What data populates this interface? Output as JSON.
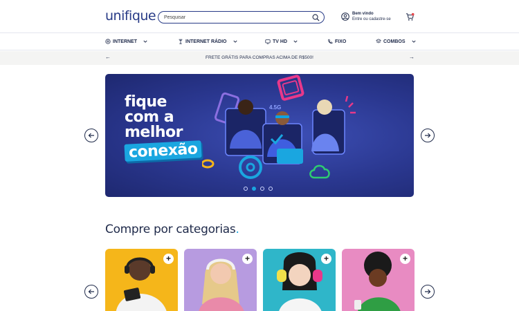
{
  "header": {
    "logo": "unifique",
    "search_placeholder": "Pesquisar",
    "user_greeting": "Bem vindo",
    "user_sub": "Entre ou cadastre-se"
  },
  "nav": {
    "items": [
      {
        "label": "INTERNET",
        "icon": "globe-icon"
      },
      {
        "label": "INTERNET RÁDIO",
        "icon": "antenna-icon"
      },
      {
        "label": "TV HD",
        "icon": "tv-icon"
      },
      {
        "label": "FIXO",
        "icon": "phone-icon"
      },
      {
        "label": "COMBOS",
        "icon": "combo-icon"
      }
    ]
  },
  "promo": {
    "text": "FRETE GRÁTIS PARA COMPRAS ACIMA DE R$500!"
  },
  "banner": {
    "line1": "fique",
    "line2": "com a",
    "line3": "melhor",
    "highlight": "conexão",
    "badge": "4.5G",
    "slides": 4,
    "active_slide": 2
  },
  "categories": {
    "title": "Compre por categorias",
    "title_dot": ".",
    "cards": [
      {
        "bg": "#f5b61a",
        "plus": "+"
      },
      {
        "bg": "#b79be0",
        "plus": "+"
      },
      {
        "bg": "#2fb6c9",
        "plus": "+"
      },
      {
        "bg": "#e88bc2",
        "plus": "+"
      }
    ]
  },
  "colors": {
    "brand": "#273a86",
    "accent": "#1aa6e0"
  }
}
